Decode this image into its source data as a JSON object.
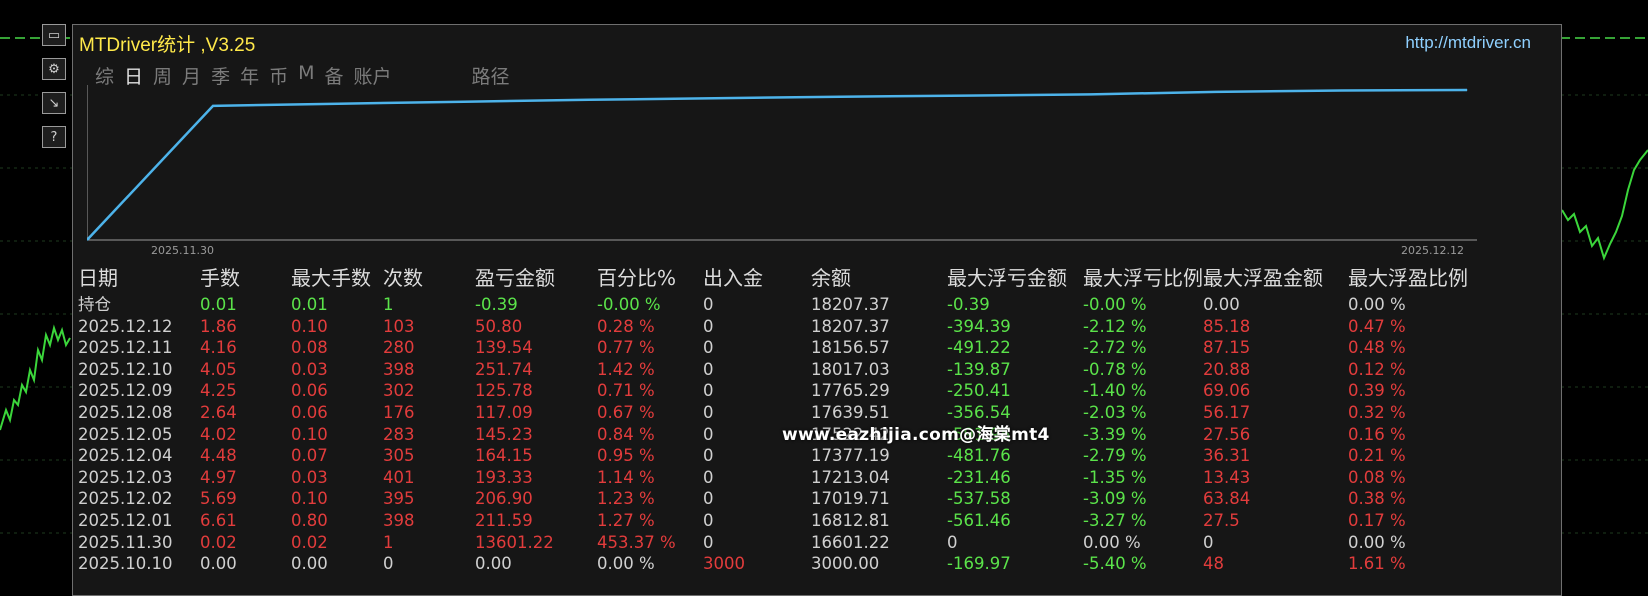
{
  "window": {
    "title": "MTDriver统计 ,V3.25",
    "url": "http://mtdriver.cn"
  },
  "tabs": [
    {
      "label": "综",
      "active": false
    },
    {
      "label": "日",
      "active": true
    },
    {
      "label": "周",
      "active": false
    },
    {
      "label": "月",
      "active": false
    },
    {
      "label": "季",
      "active": false
    },
    {
      "label": "年",
      "active": false
    },
    {
      "label": "币",
      "active": false
    },
    {
      "label": "M",
      "active": false
    },
    {
      "label": "备",
      "active": false
    },
    {
      "label": "账户",
      "active": false
    },
    {
      "label": "路径",
      "active": false
    }
  ],
  "side_buttons": [
    {
      "name": "minimize-icon",
      "glyph": "▭"
    },
    {
      "name": "settings-icon",
      "glyph": "⚙"
    },
    {
      "name": "chart-icon",
      "glyph": "↘"
    },
    {
      "name": "help-icon",
      "glyph": "?"
    }
  ],
  "chart_data": {
    "type": "line",
    "x_start_label": "2025.11.30",
    "x_end_label": "2025.12.12",
    "x": [
      "2025.11.30",
      "2025.12.01",
      "2025.12.02",
      "2025.12.03",
      "2025.12.04",
      "2025.12.05",
      "2025.12.08",
      "2025.12.09",
      "2025.12.10",
      "2025.12.11",
      "2025.12.12"
    ],
    "series": [
      {
        "values": [
          3000,
          16601.22,
          16812.81,
          17019.71,
          17213.04,
          17377.19,
          17522.42,
          17639.51,
          17765.29,
          18017.03,
          18156.57,
          18207.37
        ],
        "color": "#4db3ea"
      }
    ]
  },
  "table": {
    "headers": [
      "日期",
      "手数",
      "最大手数",
      "次数",
      "盈亏金额",
      "百分比%",
      "出入金",
      "余额",
      "最大浮亏金额",
      "最大浮亏比例",
      "最大浮盈金额",
      "最大浮盈比例"
    ],
    "rows": [
      {
        "cells": [
          "持仓",
          "0.01",
          "0.01",
          "1",
          "-0.39",
          "-0.00 %",
          "0",
          "18207.37",
          "-0.39",
          "-0.00 %",
          "0.00",
          "0.00 %"
        ],
        "colors": [
          "white",
          "green",
          "green",
          "green",
          "green",
          "green",
          "white",
          "white",
          "green",
          "green",
          "white",
          "white"
        ]
      },
      {
        "cells": [
          "2025.12.12",
          "1.86",
          "0.10",
          "103",
          "50.80",
          "0.28 %",
          "0",
          "18207.37",
          "-394.39",
          "-2.12 %",
          "85.18",
          "0.47 %"
        ],
        "colors": [
          "white",
          "red",
          "red",
          "red",
          "red",
          "red",
          "white",
          "white",
          "green",
          "green",
          "red",
          "red"
        ]
      },
      {
        "cells": [
          "2025.12.11",
          "4.16",
          "0.08",
          "280",
          "139.54",
          "0.77 %",
          "0",
          "18156.57",
          "-491.22",
          "-2.72 %",
          "87.15",
          "0.48 %"
        ],
        "colors": [
          "white",
          "red",
          "red",
          "red",
          "red",
          "red",
          "white",
          "white",
          "green",
          "green",
          "red",
          "red"
        ]
      },
      {
        "cells": [
          "2025.12.10",
          "4.05",
          "0.03",
          "398",
          "251.74",
          "1.42 %",
          "0",
          "18017.03",
          "-139.87",
          "-0.78 %",
          "20.88",
          "0.12 %"
        ],
        "colors": [
          "white",
          "red",
          "red",
          "red",
          "red",
          "red",
          "white",
          "white",
          "green",
          "green",
          "red",
          "red"
        ]
      },
      {
        "cells": [
          "2025.12.09",
          "4.25",
          "0.06",
          "302",
          "125.78",
          "0.71 %",
          "0",
          "17765.29",
          "-250.41",
          "-1.40 %",
          "69.06",
          "0.39 %"
        ],
        "colors": [
          "white",
          "red",
          "red",
          "red",
          "red",
          "red",
          "white",
          "white",
          "green",
          "green",
          "red",
          "red"
        ]
      },
      {
        "cells": [
          "2025.12.08",
          "2.64",
          "0.06",
          "176",
          "117.09",
          "0.67 %",
          "0",
          "17639.51",
          "-356.54",
          "-2.03 %",
          "56.17",
          "0.32 %"
        ],
        "colors": [
          "white",
          "red",
          "red",
          "red",
          "red",
          "red",
          "white",
          "white",
          "green",
          "green",
          "red",
          "red"
        ]
      },
      {
        "cells": [
          "2025.12.05",
          "4.02",
          "0.10",
          "283",
          "145.23",
          "0.84 %",
          "0",
          "17522.42",
          "-591.95",
          "-3.39 %",
          "27.56",
          "0.16 %"
        ],
        "colors": [
          "white",
          "red",
          "red",
          "red",
          "red",
          "red",
          "white",
          "white",
          "green",
          "green",
          "red",
          "red"
        ]
      },
      {
        "cells": [
          "2025.12.04",
          "4.48",
          "0.07",
          "305",
          "164.15",
          "0.95 %",
          "0",
          "17377.19",
          "-481.76",
          "-2.79 %",
          "36.31",
          "0.21 %"
        ],
        "colors": [
          "white",
          "red",
          "red",
          "red",
          "red",
          "red",
          "white",
          "white",
          "green",
          "green",
          "red",
          "red"
        ]
      },
      {
        "cells": [
          "2025.12.03",
          "4.97",
          "0.03",
          "401",
          "193.33",
          "1.14 %",
          "0",
          "17213.04",
          "-231.46",
          "-1.35 %",
          "13.43",
          "0.08 %"
        ],
        "colors": [
          "white",
          "red",
          "red",
          "red",
          "red",
          "red",
          "white",
          "white",
          "green",
          "green",
          "red",
          "red"
        ]
      },
      {
        "cells": [
          "2025.12.02",
          "5.69",
          "0.10",
          "395",
          "206.90",
          "1.23 %",
          "0",
          "17019.71",
          "-537.58",
          "-3.09 %",
          "63.84",
          "0.38 %"
        ],
        "colors": [
          "white",
          "red",
          "red",
          "red",
          "red",
          "red",
          "white",
          "white",
          "green",
          "green",
          "red",
          "red"
        ]
      },
      {
        "cells": [
          "2025.12.01",
          "6.61",
          "0.80",
          "398",
          "211.59",
          "1.27 %",
          "0",
          "16812.81",
          "-561.46",
          "-3.27 %",
          "27.5",
          "0.17 %"
        ],
        "colors": [
          "white",
          "red",
          "red",
          "red",
          "red",
          "red",
          "white",
          "white",
          "green",
          "green",
          "red",
          "red"
        ]
      },
      {
        "cells": [
          "2025.11.30",
          "0.02",
          "0.02",
          "1",
          "13601.22",
          "453.37 %",
          "0",
          "16601.22",
          "0",
          "0.00 %",
          "0",
          "0.00 %"
        ],
        "colors": [
          "white",
          "red",
          "red",
          "red",
          "red",
          "red",
          "white",
          "white",
          "white",
          "white",
          "white",
          "white"
        ]
      },
      {
        "cells": [
          "2025.10.10",
          "0.00",
          "0.00",
          "0",
          "0.00",
          "0.00 %",
          "3000",
          "3000.00",
          "-169.97",
          "-5.40 %",
          "48",
          "1.61 %"
        ],
        "colors": [
          "white",
          "white",
          "white",
          "white",
          "white",
          "white",
          "red",
          "white",
          "green",
          "green",
          "red",
          "red"
        ]
      }
    ]
  },
  "watermark": "www.eazhijia.com@海棠mt4"
}
